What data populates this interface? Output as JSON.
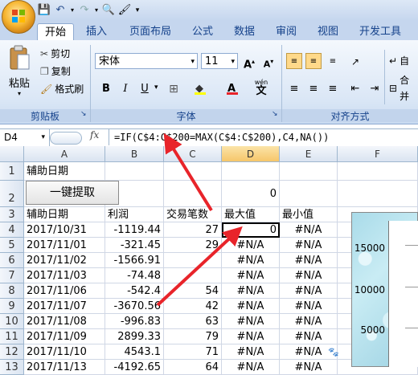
{
  "qat": {
    "icons": [
      "save-icon",
      "undo-icon",
      "redo-icon",
      "print-preview-icon",
      "format-painter-icon"
    ]
  },
  "tabs": [
    "开始",
    "插入",
    "页面布局",
    "公式",
    "数据",
    "审阅",
    "视图",
    "开发工具"
  ],
  "clipboard": {
    "paste": "粘贴",
    "cut": "剪切",
    "copy": "复制",
    "format_painter": "格式刷",
    "group": "剪贴板"
  },
  "font": {
    "name": "宋体",
    "size": "11",
    "bold": "B",
    "italic": "I",
    "underline": "U",
    "group": "字体",
    "wen": "wén",
    "wen_char": "文"
  },
  "alignment": {
    "group": "对齐方式",
    "wrap": "自",
    "merge": "合并"
  },
  "formula_bar": {
    "cell_ref": "D4",
    "fx": "fx",
    "formula": "=IF(C$4:C$200=MAX(C$4:C$200),C4,NA())"
  },
  "columns": [
    "A",
    "B",
    "C",
    "D",
    "E",
    "F"
  ],
  "rows": [
    {
      "n": "1",
      "a": "辅助日期",
      "b": "",
      "c": "",
      "d": "",
      "e": ""
    },
    {
      "n": "2",
      "a": "",
      "b": "",
      "c": "",
      "d": "0",
      "e": ""
    },
    {
      "n": "3",
      "a": "辅助日期",
      "b": "利润",
      "c": "交易笔数",
      "d": "最大值",
      "e": "最小值"
    },
    {
      "n": "4",
      "a": "2017/10/31",
      "b": "-1119.44",
      "c": "27",
      "d": "0",
      "e": "#N/A"
    },
    {
      "n": "5",
      "a": "2017/11/01",
      "b": "-321.45",
      "c": "29",
      "d": "#N/A",
      "e": "#N/A"
    },
    {
      "n": "6",
      "a": "2017/11/02",
      "b": "-1566.91",
      "c": "",
      "d": "#N/A",
      "e": "#N/A"
    },
    {
      "n": "7",
      "a": "2017/11/03",
      "b": "-74.48",
      "c": "",
      "d": "#N/A",
      "e": "#N/A"
    },
    {
      "n": "8",
      "a": "2017/11/06",
      "b": "-542.4",
      "c": "54",
      "d": "#N/A",
      "e": "#N/A"
    },
    {
      "n": "9",
      "a": "2017/11/07",
      "b": "-3670.56",
      "c": "42",
      "d": "#N/A",
      "e": "#N/A"
    },
    {
      "n": "10",
      "a": "2017/11/08",
      "b": "-996.83",
      "c": "63",
      "d": "#N/A",
      "e": "#N/A"
    },
    {
      "n": "11",
      "a": "2017/11/09",
      "b": "2899.33",
      "c": "79",
      "d": "#N/A",
      "e": "#N/A"
    },
    {
      "n": "12",
      "a": "2017/11/10",
      "b": "4543.1",
      "c": "71",
      "d": "#N/A",
      "e": "#N/A"
    },
    {
      "n": "13",
      "a": "2017/11/13",
      "b": "-4192.65",
      "c": "64",
      "d": "#N/A",
      "e": "#N/A"
    }
  ],
  "extract_button": "一键提取",
  "chart": {
    "ticks": [
      "15000",
      "10000",
      "5000"
    ]
  },
  "colors": {
    "accent": "#15428b",
    "arrow": "#e8242a",
    "selection_fill": "#ffd98a"
  }
}
